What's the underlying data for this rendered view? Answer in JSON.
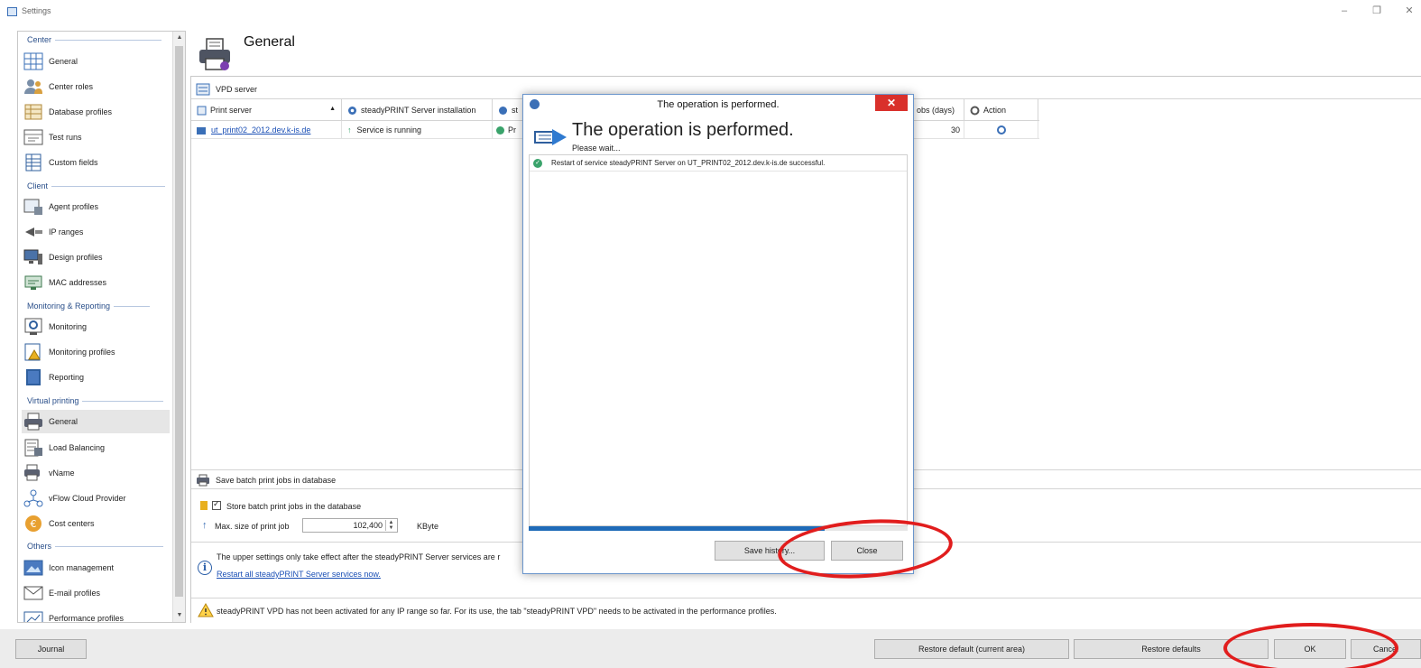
{
  "window": {
    "title": "Settings",
    "minimize": "–",
    "maximize": "❐",
    "close": "✕"
  },
  "sidebar": {
    "groups": [
      {
        "title": "Center",
        "items": [
          {
            "label": "General",
            "icon": "grid-icon"
          },
          {
            "label": "Center roles",
            "icon": "users-icon"
          },
          {
            "label": "Database profiles",
            "icon": "database-icon"
          },
          {
            "label": "Test runs",
            "icon": "test-icon"
          },
          {
            "label": "Custom fields",
            "icon": "fields-icon"
          }
        ]
      },
      {
        "title": "Client",
        "items": [
          {
            "label": "Agent profiles",
            "icon": "agent-icon"
          },
          {
            "label": "IP ranges",
            "icon": "network-icon"
          },
          {
            "label": "Design profiles",
            "icon": "design-icon"
          },
          {
            "label": "MAC addresses",
            "icon": "mac-icon"
          }
        ]
      },
      {
        "title": "Monitoring & Reporting",
        "items": [
          {
            "label": "Monitoring",
            "icon": "monitoring-icon"
          },
          {
            "label": "Monitoring profiles",
            "icon": "monitoring-profile-icon"
          },
          {
            "label": "Reporting",
            "icon": "reporting-icon"
          }
        ]
      },
      {
        "title": "Virtual printing",
        "items": [
          {
            "label": "General",
            "icon": "printer-icon",
            "active": true
          },
          {
            "label": "Load Balancing",
            "icon": "load-balancing-icon"
          },
          {
            "label": "vName",
            "icon": "vname-icon"
          },
          {
            "label": "vFlow Cloud Provider",
            "icon": "cloud-icon"
          },
          {
            "label": "Cost centers",
            "icon": "cost-icon"
          }
        ]
      },
      {
        "title": "Others",
        "items": [
          {
            "label": "Icon management",
            "icon": "image-icon"
          },
          {
            "label": "E-mail profiles",
            "icon": "email-icon"
          },
          {
            "label": "Performance profiles",
            "icon": "performance-icon"
          }
        ]
      }
    ]
  },
  "main": {
    "title": "General",
    "section_vpd": "VPD server",
    "table": {
      "columns": [
        "Print server",
        "steadyPRINT Server installation",
        "st",
        "obs (days)",
        "Action"
      ],
      "rows": [
        {
          "server": "ut_print02_2012.dev.k-is.de",
          "status": "Service is running",
          "third": "Pr",
          "days": "30"
        }
      ]
    },
    "section_batch": "Save batch print jobs in database",
    "store_checkbox_label": "Store batch print jobs in the database",
    "max_size_label": "Max. size of print job",
    "max_size_value": "102,400",
    "max_size_unit": "KByte",
    "info_text": "The upper settings only take effect after the steadyPRINT Server services are r",
    "info_link": "Restart all steadyPRINT Server services now.",
    "warning_text": "steadyPRINT VPD has not been activated for any IP range so far. For its use, the tab \"steadyPRINT VPD\" needs to be activated in the performance profiles."
  },
  "dialog": {
    "title": "The operation is performed.",
    "heading": "The operation is performed.",
    "subheading": "Please wait...",
    "log": [
      "Restart of service steadyPRINT Server on UT_PRINT02_2012.dev.k-is.de successful."
    ],
    "progress": 0.78,
    "save_history_label": "Save history...",
    "close_label": "Close",
    "close_x": "✕"
  },
  "bottom": {
    "journal": "Journal",
    "restore_current": "Restore default (current area)",
    "restore_all": "Restore defaults",
    "ok": "OK",
    "cancel": "Cancel"
  },
  "colors": {
    "accent": "#1f6bb8",
    "annotation": "#e11d1d",
    "dialog_close": "#d9302b",
    "success": "#3aa36b"
  }
}
